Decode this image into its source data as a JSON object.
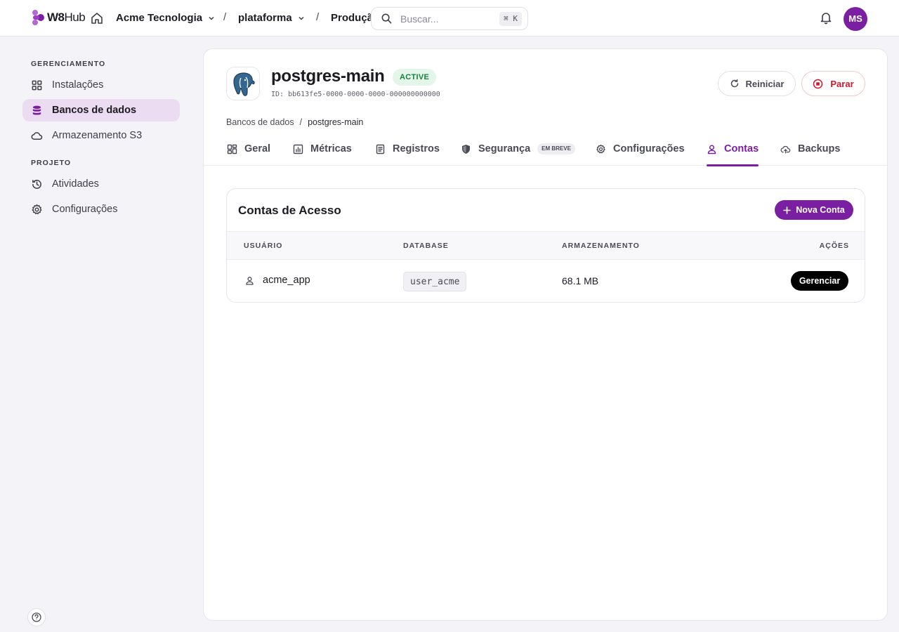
{
  "topbar": {
    "logo_bold": "W8",
    "logo_thin": "Hub",
    "org": "Acme Tecnologia",
    "project": "plataforma",
    "environment": "Produçã",
    "search_placeholder": "Buscar...",
    "search_shortcut": "⌘ K",
    "avatar_initials": "MS"
  },
  "sidebar": {
    "section_management": "GERENCIAMENTO",
    "section_project": "PROJETO",
    "items": [
      {
        "label": "Instalações",
        "icon": "grid-icon"
      },
      {
        "label": "Bancos de dados",
        "icon": "database-icon",
        "active": true
      },
      {
        "label": "Armazenamento S3",
        "icon": "cloud-icon"
      },
      {
        "label": "Atividades",
        "icon": "history-icon"
      },
      {
        "label": "Configurações",
        "icon": "gear-icon"
      }
    ]
  },
  "database": {
    "name": "postgres-main",
    "status": "ACTIVE",
    "id_text": "ID: bb613fe5-0000-0000-0000-000000000000",
    "restart_label": "Reiniciar",
    "stop_label": "Parar"
  },
  "breadcrumb": {
    "parent": "Bancos de dados",
    "separator": "/",
    "current": "postgres-main"
  },
  "tabs": [
    {
      "label": "Geral",
      "icon": "dashboard-icon"
    },
    {
      "label": "Métricas",
      "icon": "chart-icon"
    },
    {
      "label": "Registros",
      "icon": "logs-icon"
    },
    {
      "label": "Segurança",
      "icon": "shield-icon",
      "badge": "EM BREVE"
    },
    {
      "label": "Configurações",
      "icon": "gear-icon"
    },
    {
      "label": "Contas",
      "icon": "user-icon",
      "active": true
    },
    {
      "label": "Backups",
      "icon": "cloud-upload-icon"
    }
  ],
  "accounts": {
    "title": "Contas de Acesso",
    "new_button": "Nova Conta",
    "columns": [
      "USUÁRIO",
      "DATABASE",
      "ARMAZENAMENTO",
      "AÇÕES"
    ],
    "rows": [
      {
        "user": "acme_app",
        "database": "user_acme",
        "storage": "68.1 MB",
        "action": "Gerenciar"
      }
    ]
  },
  "colors": {
    "accent": "#7b1fa2",
    "active_badge_bg": "#e4f6ea",
    "active_badge_text": "#17803d",
    "stop": "#d0172c"
  }
}
